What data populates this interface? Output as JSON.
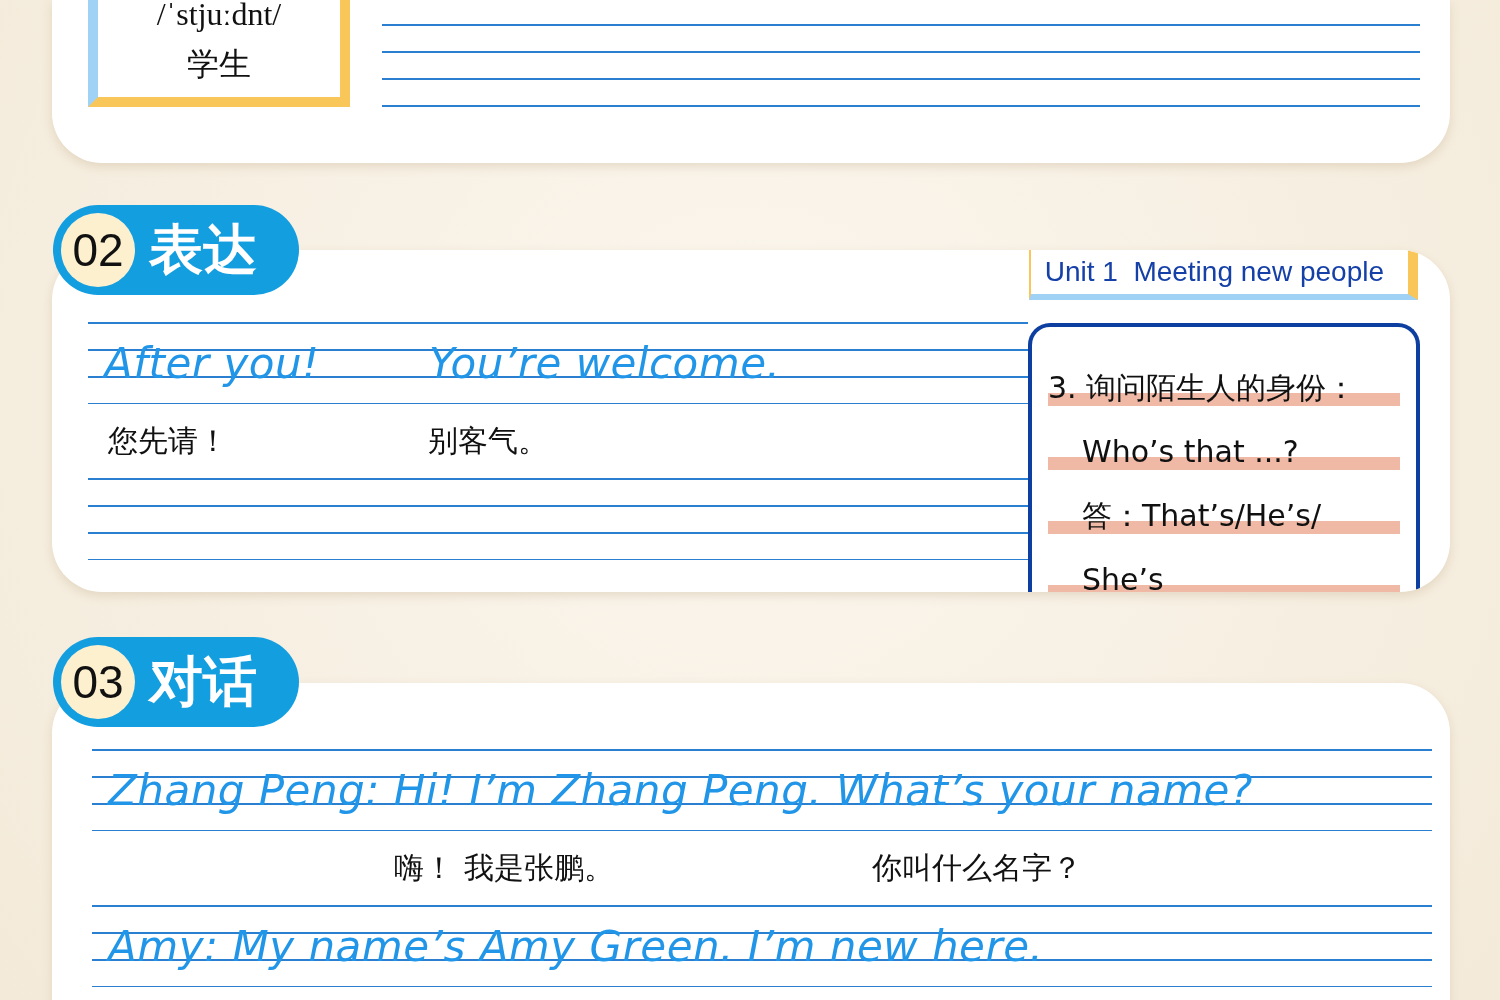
{
  "word_card": {
    "phonetic": "/ˈstjuːdnt/",
    "meaning": "学生"
  },
  "sections": [
    {
      "number": "02",
      "title": "表达",
      "unit_tag": "Unit 1  Meeting new people",
      "entries": [
        {
          "kind": "english",
          "texts": [
            "After you!",
            "You’re welcome."
          ]
        },
        {
          "kind": "chinese",
          "texts": [
            "您先请！",
            "别客气。"
          ]
        },
        {
          "kind": "blank"
        }
      ],
      "note": [
        "3. 询问陌生人的身份：",
        "Who’s that ...?",
        "答：That’s/He’s/",
        "She’s"
      ]
    },
    {
      "number": "03",
      "title": "对话",
      "entries": [
        {
          "kind": "english",
          "texts": [
            "Zhang Peng: Hi! I’m Zhang Peng. What’s your name?"
          ]
        },
        {
          "kind": "chinese",
          "texts": [
            "嗨！ 我是张鹏。",
            "你叫什么名字？"
          ]
        },
        {
          "kind": "english",
          "texts": [
            "Amy: My name’s Amy Green. I’m new here."
          ]
        }
      ]
    }
  ]
}
